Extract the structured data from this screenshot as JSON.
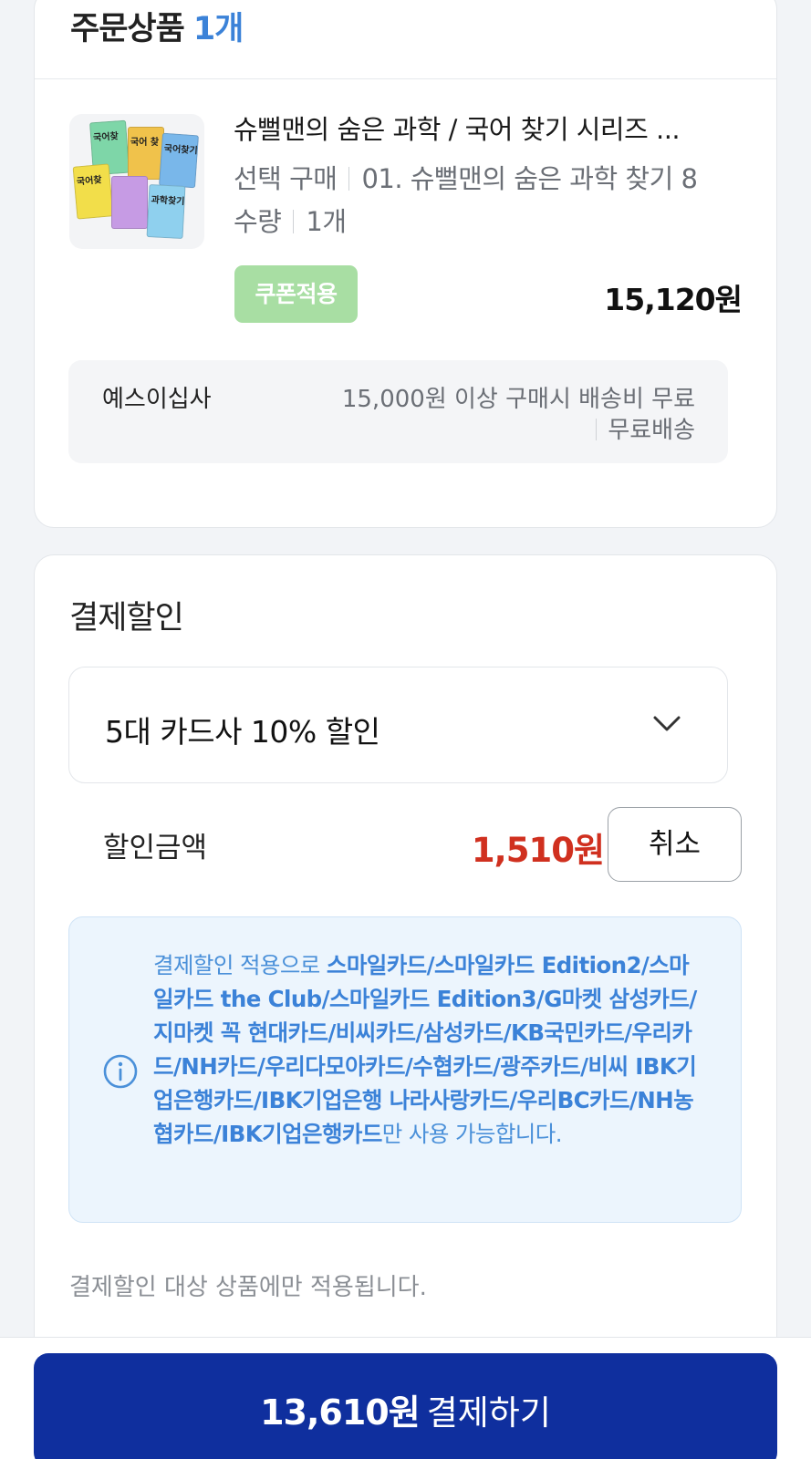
{
  "order": {
    "title": "주문상품",
    "count": "1개",
    "product": {
      "name": "슈뻘맨의 숨은 과학 / 국어 찾기 시리즈 ...",
      "option_label": "선택 구매",
      "option_value": "01. 슈뻘맨의 숨은 과학 찾기 8",
      "qty_label": "수량",
      "qty_value": "1개",
      "coupon_button": "쿠폰적용",
      "price": "15,120원",
      "thumbnail_text": [
        "국어찾",
        "국어 찾",
        "국어찾기",
        "국어찾",
        "과학찾기"
      ]
    },
    "shipping": {
      "seller": "예스이십사",
      "condition": "15,000원 이상 구매시 배송비 무료",
      "fee": "무료배송"
    }
  },
  "payment_discount": {
    "title": "결제할인",
    "selected_option": "5대 카드사 10% 할인",
    "discount_label": "할인금액",
    "discount_amount": "1,510원",
    "cancel_button": "취소",
    "info": {
      "prefix": "결제할인 적용으로 ",
      "cards": "스마일카드/스마일카드 Edition2/스마일카드 the Club/스마일카드 Edition3/G마켓 삼성카드/지마켓 꼭 현대카드/비씨카드/삼성카드/KB국민카드/우리카드/NH카드/우리다모아카드/수협카드/광주카드/비씨 IBK기업은행카드/IBK기업은행 나라사랑카드/우리BC카드/NH농협카드/IBK기업은행카드",
      "suffix": "만 사용 가능합니다."
    },
    "note": "결제할인 대상 상품에만 적용됩니다."
  },
  "checkout": {
    "amount": "13,610원",
    "label": "결제하기"
  },
  "colors": {
    "accent_blue": "#3b82d8",
    "discount_red": "#d0301f",
    "pay_button": "#0f2f9e",
    "coupon_green": "#a8dea3"
  }
}
